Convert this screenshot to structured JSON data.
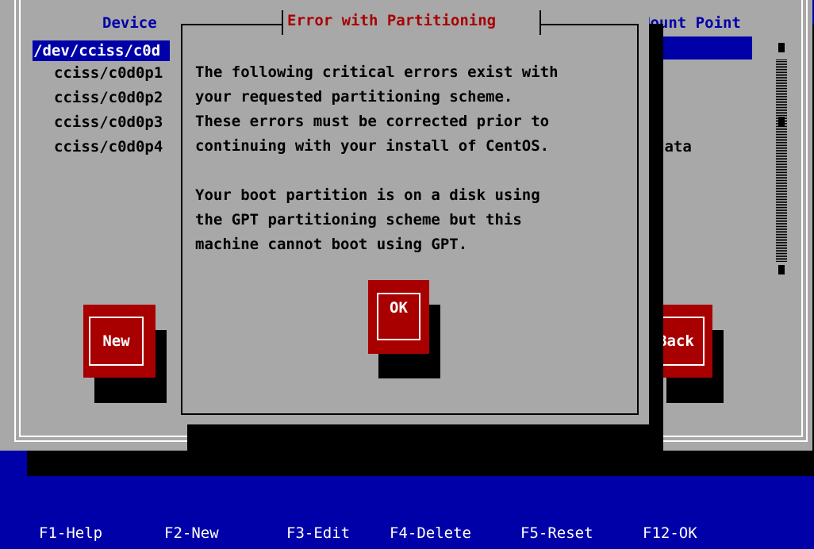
{
  "partition_table": {
    "headers": {
      "device": "Device",
      "mount_point": "Mount Point"
    },
    "devices": [
      {
        "name": "/dev/cciss/c0d",
        "selected": true
      },
      {
        "name": "cciss/c0d0p1"
      },
      {
        "name": "cciss/c0d0p2"
      },
      {
        "name": "cciss/c0d0p3"
      },
      {
        "name": "cciss/c0d0p4",
        "mount_point": "data"
      }
    ]
  },
  "buttons": {
    "new_label": "New",
    "back_label": "Back",
    "ok_label": "OK"
  },
  "dialog": {
    "title": "Error with Partitioning",
    "message_lines": [
      "The following critical errors exist with",
      "your requested partitioning scheme.",
      "These errors must be corrected prior to",
      "continuing with your install of CentOS.",
      "",
      "Your boot partition is on a disk using",
      "the GPT partitioning scheme but this",
      "machine cannot boot using GPT."
    ]
  },
  "footer_keys": [
    "F1-Help",
    "F2-New",
    "F3-Edit",
    "F4-Delete",
    "F5-Reset",
    "F12-OK"
  ],
  "colors": {
    "background": "#0000a8",
    "panel": "#a8a8a8",
    "button": "#a80000",
    "title": "#a80000"
  }
}
